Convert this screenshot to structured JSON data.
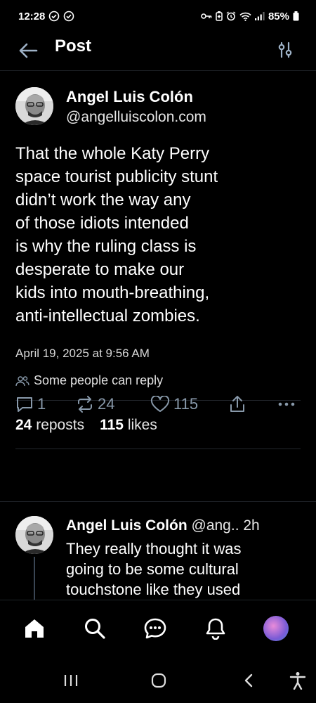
{
  "status_bar": {
    "time": "12:28",
    "battery": "85%"
  },
  "header": {
    "title": "Post"
  },
  "post": {
    "author_name": "Angel Luis Colón",
    "author_handle": "@angelluiscolon.com",
    "text_lines": [
      "That the whole Katy Perry",
      "space tourist publicity stunt",
      "didn’t work the way any",
      "of those idiots intended",
      "is why the ruling class is",
      "desperate to make our",
      "kids into mouth-breathing,",
      "anti-intellectual zombies."
    ],
    "date": "April 19, 2025 at 9:56 AM",
    "reply_setting": "Some people can reply",
    "reposts_count": "24",
    "reposts_label": "reposts",
    "likes_count": "115",
    "likes_label": "likes",
    "actions": {
      "reply_count": "1",
      "repost_count": "24",
      "like_count": "115"
    }
  },
  "reply": {
    "author_name": "Angel Luis Colón",
    "handle_truncated": "@ang..",
    "time": "2h",
    "text_lines": [
      "They really thought it was",
      "going to be some cultural",
      "touchstone like they used"
    ]
  },
  "icons": {
    "back": "arrow-left-icon",
    "filter": "sliders-icon",
    "reply": "speech-bubble-icon",
    "repost": "repost-arrows-icon",
    "like": "heart-icon",
    "share": "share-up-icon",
    "more": "ellipsis-icon",
    "nav_home": "home-icon",
    "nav_search": "search-icon",
    "nav_chat": "chat-icon",
    "nav_notifications": "bell-icon"
  },
  "colors": {
    "background": "#000000",
    "muted_icon": "#8899aa",
    "text": "#ffffff"
  }
}
